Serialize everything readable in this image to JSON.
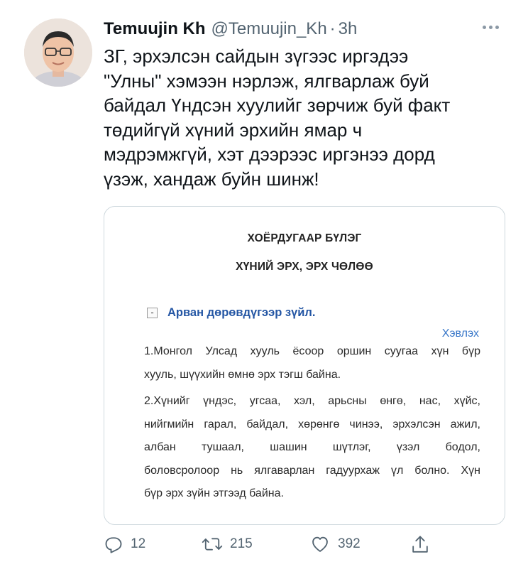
{
  "author": {
    "name": "Temuujin Kh",
    "handle": "@Temuujin_Kh",
    "separator": "·",
    "time": "3h"
  },
  "tweet": {
    "lines": [
      "ЗГ, эрхэлсэн сайдын зүгээс иргэдээ",
      "\"Улны\" хэмээн нэрлэж, ялгварлаж буй",
      "байдал Үндсэн хуулийг зөрчиж буй факт",
      "төдийгүй хүний эрхийн ямар ч",
      "мэдрэмжгүй, хэт дээрээс иргэнээ дорд",
      "үзэж, хандаж буйн шинж!"
    ]
  },
  "card": {
    "chapter": "ХОЁРДУГААР БҮЛЭГ",
    "chapter_title": "ХҮНИЙ ЭРХ, ЭРХ ЧӨЛӨӨ",
    "toggle": "-",
    "article_title": "Арван дөрөвдүгээр зүйл.",
    "print_link": "Хэвлэх",
    "para1": [
      "1.Монгол Улсад хууль ёсоор оршин суугаа хүн бүр",
      "хууль, шүүхийн өмнө эрх тэгш байна."
    ],
    "para2": [
      "2.Хүнийг үндэс, угсаа, хэл, арьсны өнгө, нас, хүйс,",
      "нийгмийн гарал, байдал, хөрөнгө чинээ, эрхэлсэн ажил,",
      "албан тушаал, шашин шүтлэг, үзэл бодол,",
      "боловсролоор нь ялгаварлан гадуурхаж үл болно. Хүн",
      "бүр эрх зүйн этгээд байна."
    ]
  },
  "actions": {
    "replies": "12",
    "retweets": "215",
    "likes": "392"
  },
  "icons": {
    "more": "more-icon",
    "reply": "reply-icon",
    "retweet": "retweet-icon",
    "like": "like-icon",
    "share": "share-icon"
  },
  "colors": {
    "text": "#0f1419",
    "muted": "#536471",
    "article_link": "#2456a4"
  }
}
